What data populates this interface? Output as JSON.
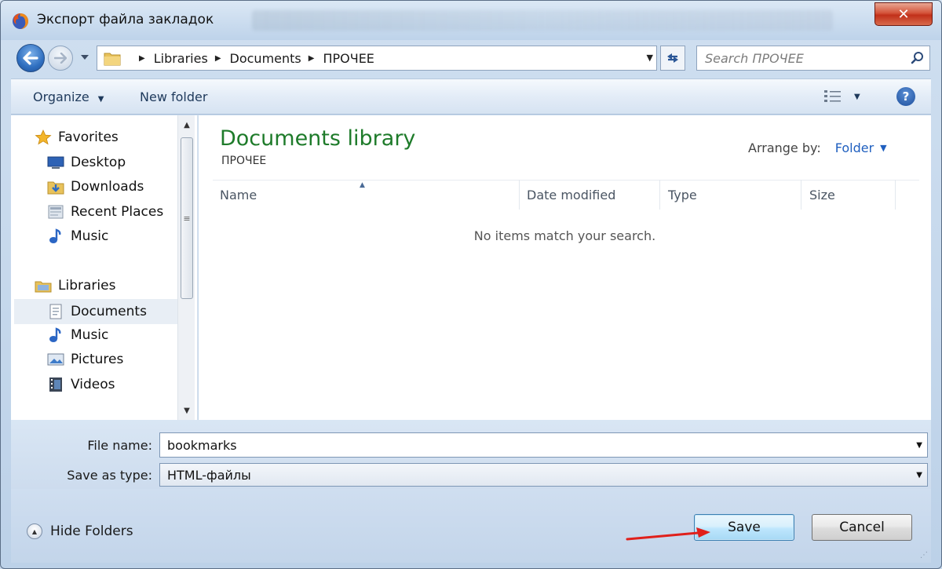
{
  "window": {
    "title": "Экспорт файла закладок",
    "close_glyph": "✕"
  },
  "address_bar": {
    "crumbs": [
      "Libraries",
      "Documents",
      "ПРОЧЕЕ"
    ]
  },
  "search": {
    "placeholder": "Search ПРОЧЕЕ"
  },
  "toolbar": {
    "organize_label": "Organize",
    "new_folder_label": "New folder",
    "help_glyph": "?"
  },
  "nav_pane": {
    "favorites": {
      "label": "Favorites",
      "items": [
        {
          "label": "Desktop",
          "icon": "desktop-icon"
        },
        {
          "label": "Downloads",
          "icon": "downloads-icon"
        },
        {
          "label": "Recent Places",
          "icon": "recent-places-icon"
        },
        {
          "label": "Music",
          "icon": "music-icon"
        }
      ]
    },
    "libraries": {
      "label": "Libraries",
      "items": [
        {
          "label": "Documents",
          "icon": "documents-icon",
          "selected": true
        },
        {
          "label": "Music",
          "icon": "music-icon"
        },
        {
          "label": "Pictures",
          "icon": "pictures-icon"
        },
        {
          "label": "Videos",
          "icon": "videos-icon"
        }
      ]
    }
  },
  "content": {
    "library_title": "Documents library",
    "library_subtitle": "ПРОЧЕЕ",
    "arrange_by_label": "Arrange by:",
    "arrange_by_value": "Folder",
    "columns": [
      "Name",
      "Date modified",
      "Type",
      "Size"
    ],
    "empty_message": "No items match your search."
  },
  "form": {
    "file_name_label": "File name:",
    "file_name_value": "bookmarks",
    "save_as_type_label": "Save as type:",
    "save_as_type_value": "HTML-файлы"
  },
  "footer": {
    "hide_folders_label": "Hide Folders",
    "save_label": "Save",
    "cancel_label": "Cancel"
  },
  "colors": {
    "library_title": "#1e7b2a",
    "link_blue": "#1f5fbf",
    "close_red": "#c1301a",
    "annotation_arrow": "#e0201b"
  }
}
